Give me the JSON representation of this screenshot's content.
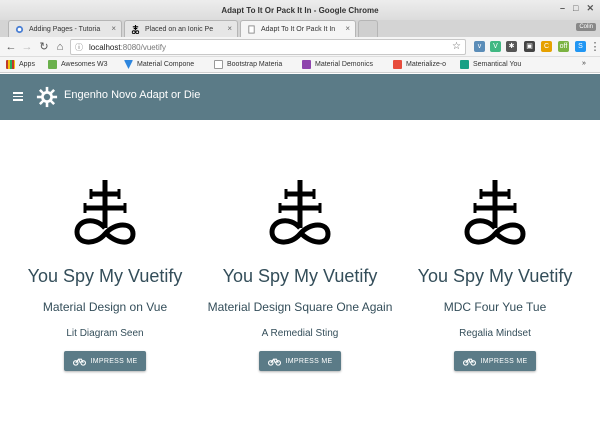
{
  "window": {
    "title": "Adapt To It Or Pack It In - Google Chrome",
    "user_badge": "Colin"
  },
  "tabs": [
    {
      "label": "Adding Pages - Tutoria",
      "icon": "globe-icon"
    },
    {
      "label": "Placed on an Ionic Pe",
      "icon": "leviathan-cross-icon"
    },
    {
      "label": "Adapt To It Or Pack It In",
      "icon": "page-icon",
      "active": true
    }
  ],
  "toolbar": {
    "url_host": "localhost",
    "url_rest": ":8080/vuetify"
  },
  "bookmarks": [
    {
      "label": "Apps",
      "color": "#c0392b"
    },
    {
      "label": "Awesomes W3",
      "color": "#6ab04c"
    },
    {
      "label": "Material Compone",
      "color": "#2e86de"
    },
    {
      "label": "Bootstrap Materia",
      "color": "#ffffff"
    },
    {
      "label": "Material Demonics",
      "color": "#8e44ad"
    },
    {
      "label": "Materialize-o",
      "color": "#e74c3c"
    },
    {
      "label": "Semantical You",
      "color": "#16a085"
    }
  ],
  "appbar": {
    "title": "Engenho Novo Adapt or Die"
  },
  "cards": [
    {
      "title": "You Spy My Vuetify",
      "subtitle": "Material Design on Vue",
      "caption": "Lit Diagram Seen",
      "button": "IMPRESS ME"
    },
    {
      "title": "You Spy My Vuetify",
      "subtitle": "Material Design Square One Again",
      "caption": "A Remedial Sting",
      "button": "IMPRESS ME"
    },
    {
      "title": "You Spy My Vuetify",
      "subtitle": "MDC Four Yue Tue",
      "caption": "Regalia Mindset",
      "button": "IMPRESS ME"
    }
  ],
  "colors": {
    "appbar": "#5b7b87",
    "text": "#344e5a",
    "button": "#5b7b87"
  }
}
